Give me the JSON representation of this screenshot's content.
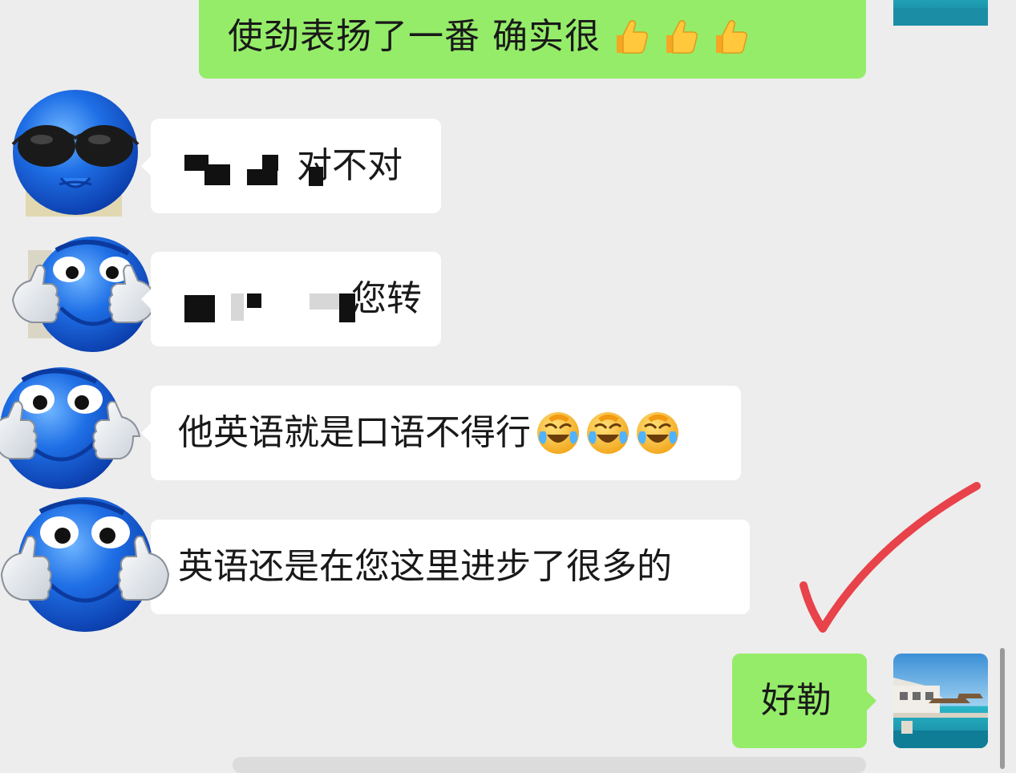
{
  "messages": [
    {
      "id": "m1",
      "side": "out",
      "text": "使劲表扬了一番 确实很",
      "emoji": [
        "thumbs-up",
        "thumbs-up",
        "thumbs-up"
      ]
    },
    {
      "id": "m2",
      "side": "in",
      "text": "对不对"
    },
    {
      "id": "m3",
      "side": "in",
      "text": "您转"
    },
    {
      "id": "m4",
      "side": "in",
      "text": "他英语就是口语不得行",
      "emoji": [
        "laughing-crying",
        "laughing-crying",
        "laughing-crying"
      ]
    },
    {
      "id": "m5",
      "side": "in",
      "text": "英语还是在您这里进步了很多的"
    },
    {
      "id": "m6",
      "side": "out",
      "text": "好勒"
    }
  ],
  "colors": {
    "background": "#ededed",
    "outgoing_bubble": "#95ec69",
    "incoming_bubble": "#ffffff",
    "annotation_check": "#e8424a",
    "avatar_blue": "#1f6fe6"
  },
  "icons": {
    "avatar_contact": "blue-smiley-avatar",
    "avatar_self": "resort-photo-avatar",
    "annotation": "red-checkmark"
  }
}
